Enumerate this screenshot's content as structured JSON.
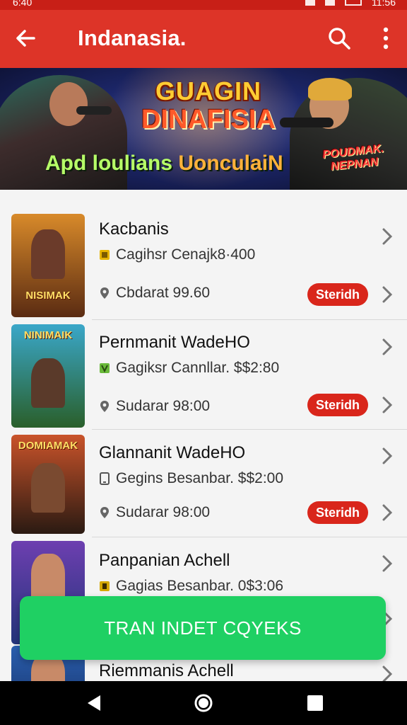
{
  "status": {
    "time": "6:40",
    "right_text": "11:56"
  },
  "appbar": {
    "title": "Indanasia."
  },
  "banner": {
    "logo_line1": "GUAGIN",
    "logo_line2": "DINAFISIA",
    "caption_main": "Apd loulians",
    "caption_tail": "Uonculai",
    "caption_end": "N",
    "badge_line1": "POUDMAK.",
    "badge_line2": "NEPNAN"
  },
  "items": [
    {
      "name": "Kacbanis",
      "detail": "Cagihsr Cenajk8·400",
      "location": "Cbdarat 99.60",
      "tag": "Steridh",
      "thumb_title": "NISIMAK",
      "thumb_colors": [
        "#d88a2a",
        "#5a2b12"
      ]
    },
    {
      "name": "Pernmanit WadeHO",
      "detail": "Gagiksr Cannllar. $$2:80",
      "location": "Sudarar 98:00",
      "tag": "Steridh",
      "thumb_title": "NINIMAIK",
      "thumb_colors": [
        "#3aa7c9",
        "#2a5f2a"
      ]
    },
    {
      "name": "Glannanit WadeHO",
      "detail": "Gegins Besanbar. $$2:00",
      "location": "Sudarar 98:00",
      "tag": "Steridh",
      "thumb_title": "DOMIAMAK",
      "thumb_colors": [
        "#c9532a",
        "#2a1a12"
      ]
    },
    {
      "name": "Panpanian Achell",
      "detail": "Gagias Besanbar. 0$3:06",
      "location": "",
      "tag": "",
      "thumb_title": "",
      "thumb_colors": [
        "#6d3fb0",
        "#23347a"
      ]
    },
    {
      "name": "Riemmanis Achell",
      "detail": "",
      "location": "",
      "tag": "",
      "thumb_title": "",
      "thumb_colors": [
        "#2a5fb0",
        "#10204a"
      ]
    }
  ],
  "fab": {
    "label": "TRAN INDET CQYEKS"
  },
  "colors": {
    "primary": "#dd3428",
    "accent": "#1fd063",
    "tag": "#d9261b"
  }
}
